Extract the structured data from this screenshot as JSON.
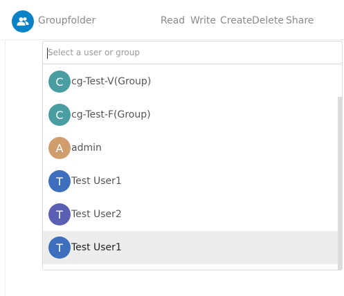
{
  "header": {
    "group_title": "Groupfolder",
    "group_icon": "group-icon",
    "columns": {
      "read": "Read",
      "write": "Write",
      "create": "Create",
      "delete": "Delete",
      "share": "Share"
    }
  },
  "search": {
    "value": "",
    "placeholder": "Select a user or group"
  },
  "items": [
    {
      "initial": "C",
      "label": "cg-Test-V(Group)",
      "color": "#4a9ea1"
    },
    {
      "initial": "C",
      "label": "cg-Test-F(Group)",
      "color": "#4a9ea1"
    },
    {
      "initial": "A",
      "label": "admin",
      "color": "#d09e6d"
    },
    {
      "initial": "T",
      "label": "Test User1",
      "color": "#3e6fbf"
    },
    {
      "initial": "T",
      "label": "Test User2",
      "color": "#5b5fb3"
    },
    {
      "initial": "T",
      "label": "Test User1",
      "color": "#3e6fbf",
      "highlighted": true
    }
  ],
  "colors": {
    "accent": "#0a82c8",
    "highlight": "#ededed"
  }
}
